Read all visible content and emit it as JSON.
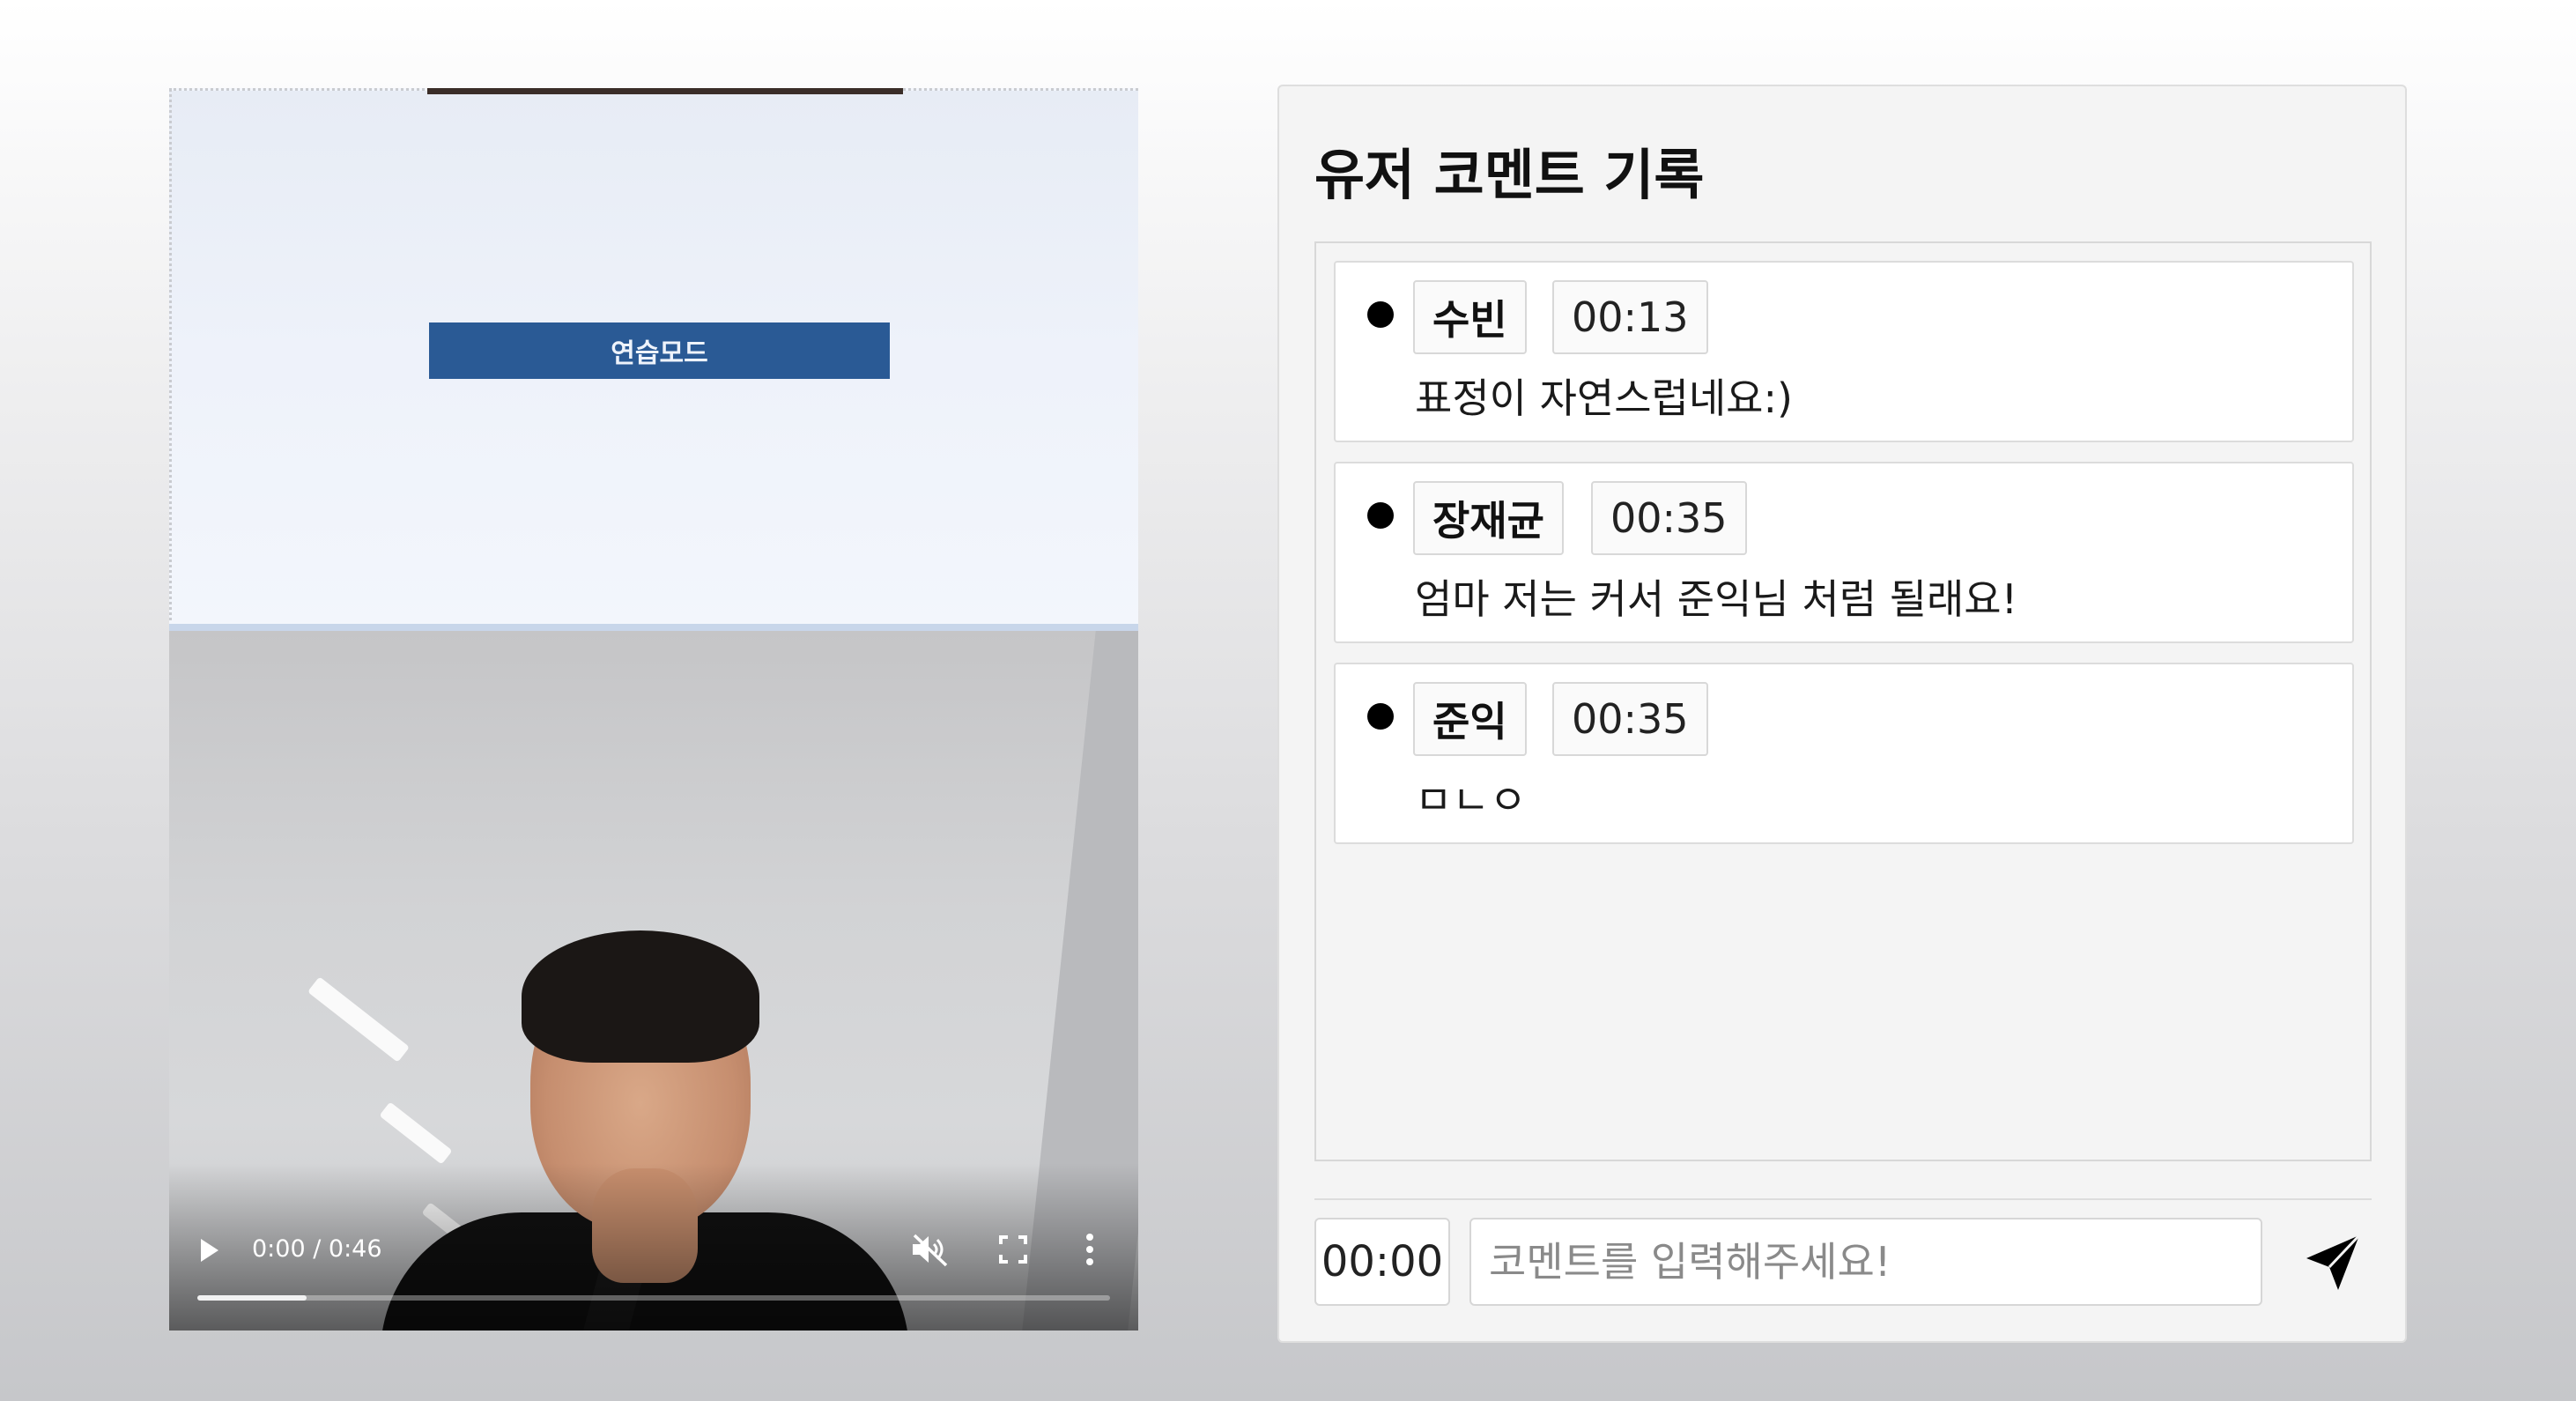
{
  "video": {
    "practice_button_label": "연습모드",
    "time_display": "0:00 / 0:46",
    "progress": 0.12
  },
  "panel": {
    "title": "유저 코멘트 기록",
    "comments": [
      {
        "author": "수빈",
        "timestamp": "00:13",
        "text": "표정이 자연스럽네요:)"
      },
      {
        "author": "장재균",
        "timestamp": "00:35",
        "text": "엄마 저는 커서 준익님 처럼 될래요!"
      },
      {
        "author": "준익",
        "timestamp": "00:35",
        "text": "ㅁㄴㅇ"
      }
    ],
    "current_time": "00:00",
    "input_placeholder": "코멘트를 입력해주세요!"
  },
  "icons": {
    "play": "play-icon",
    "mute": "volume-muted-icon",
    "fullscreen": "fullscreen-icon",
    "more": "more-vertical-icon",
    "send": "send-paper-plane-icon"
  }
}
